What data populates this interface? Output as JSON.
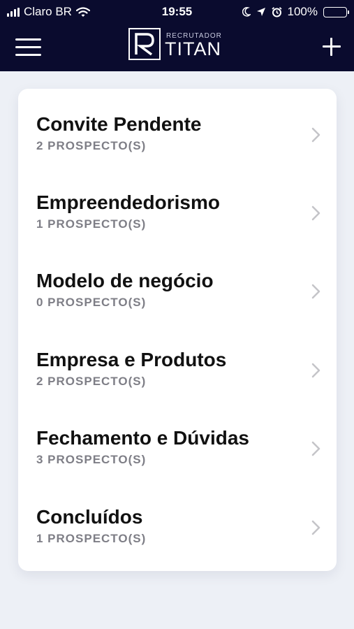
{
  "status_bar": {
    "carrier": "Claro BR",
    "time": "19:55",
    "battery": "100%",
    "battery_level": 1.0
  },
  "header": {
    "logo_small": "RECRUTADOR",
    "logo_main": "TITAN",
    "menu_icon": "hamburger-icon",
    "add_icon": "plus-icon",
    "background_color": "#0a0b2e"
  },
  "list": [
    {
      "title": "Convite Pendente",
      "subtitle": "2 PROSPECTO(S)"
    },
    {
      "title": "Empreendedorismo",
      "subtitle": "1 PROSPECTO(S)"
    },
    {
      "title": "Modelo de negócio",
      "subtitle": "0 PROSPECTO(S)"
    },
    {
      "title": "Empresa e Produtos",
      "subtitle": "2 PROSPECTO(S)"
    },
    {
      "title": "Fechamento e Dúvidas",
      "subtitle": "3 PROSPECTO(S)"
    },
    {
      "title": "Concluídos",
      "subtitle": "1 PROSPECTO(S)"
    }
  ]
}
